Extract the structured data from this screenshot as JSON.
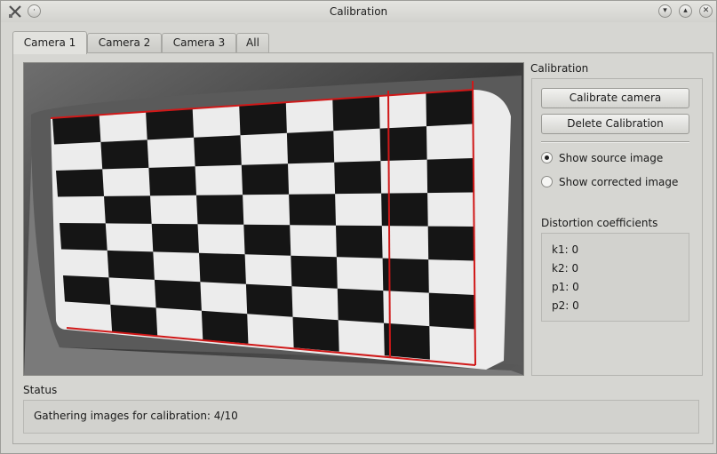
{
  "window": {
    "title": "Calibration"
  },
  "tabs": [
    "Camera 1",
    "Camera 2",
    "Camera 3",
    "All"
  ],
  "calibration": {
    "title": "Calibration",
    "calibrate_label": "Calibrate camera",
    "delete_label": "Delete Calibration",
    "show_source_label": "Show source image",
    "show_corrected_label": "Show corrected image",
    "selected_view": "source"
  },
  "distortion": {
    "title": "Distortion coefficients",
    "k1": "k1: 0",
    "k2": "k2: 0",
    "p1": "p1: 0",
    "p2": "p2: 0"
  },
  "status": {
    "title": "Status",
    "message": "Gathering images for calibration: 4/10"
  },
  "colors": {
    "overlay_line": "#d01818"
  }
}
